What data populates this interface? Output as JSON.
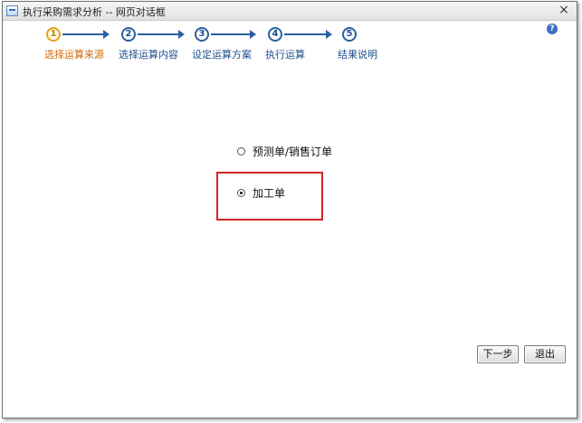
{
  "window": {
    "title": "执行采购需求分析 -- 网页对话框",
    "close_icon": "close-icon",
    "help_icon": "help-icon"
  },
  "wizard": {
    "steps": [
      {
        "number": "1",
        "label": "选择运算来源",
        "active": true
      },
      {
        "number": "2",
        "label": "选择运算内容",
        "active": false
      },
      {
        "number": "3",
        "label": "设定运算方案",
        "active": false
      },
      {
        "number": "4",
        "label": "执行运算",
        "active": false
      },
      {
        "number": "5",
        "label": "结果说明",
        "active": false
      }
    ]
  },
  "source_options": [
    {
      "label": "预测单/销售订单",
      "checked": false
    },
    {
      "label": "加工单",
      "checked": true
    }
  ],
  "buttons": {
    "next": "下一步",
    "exit": "退出"
  },
  "colors": {
    "active_step": "#e6a320",
    "step": "#2b5f9e",
    "highlight": "#d22626"
  }
}
